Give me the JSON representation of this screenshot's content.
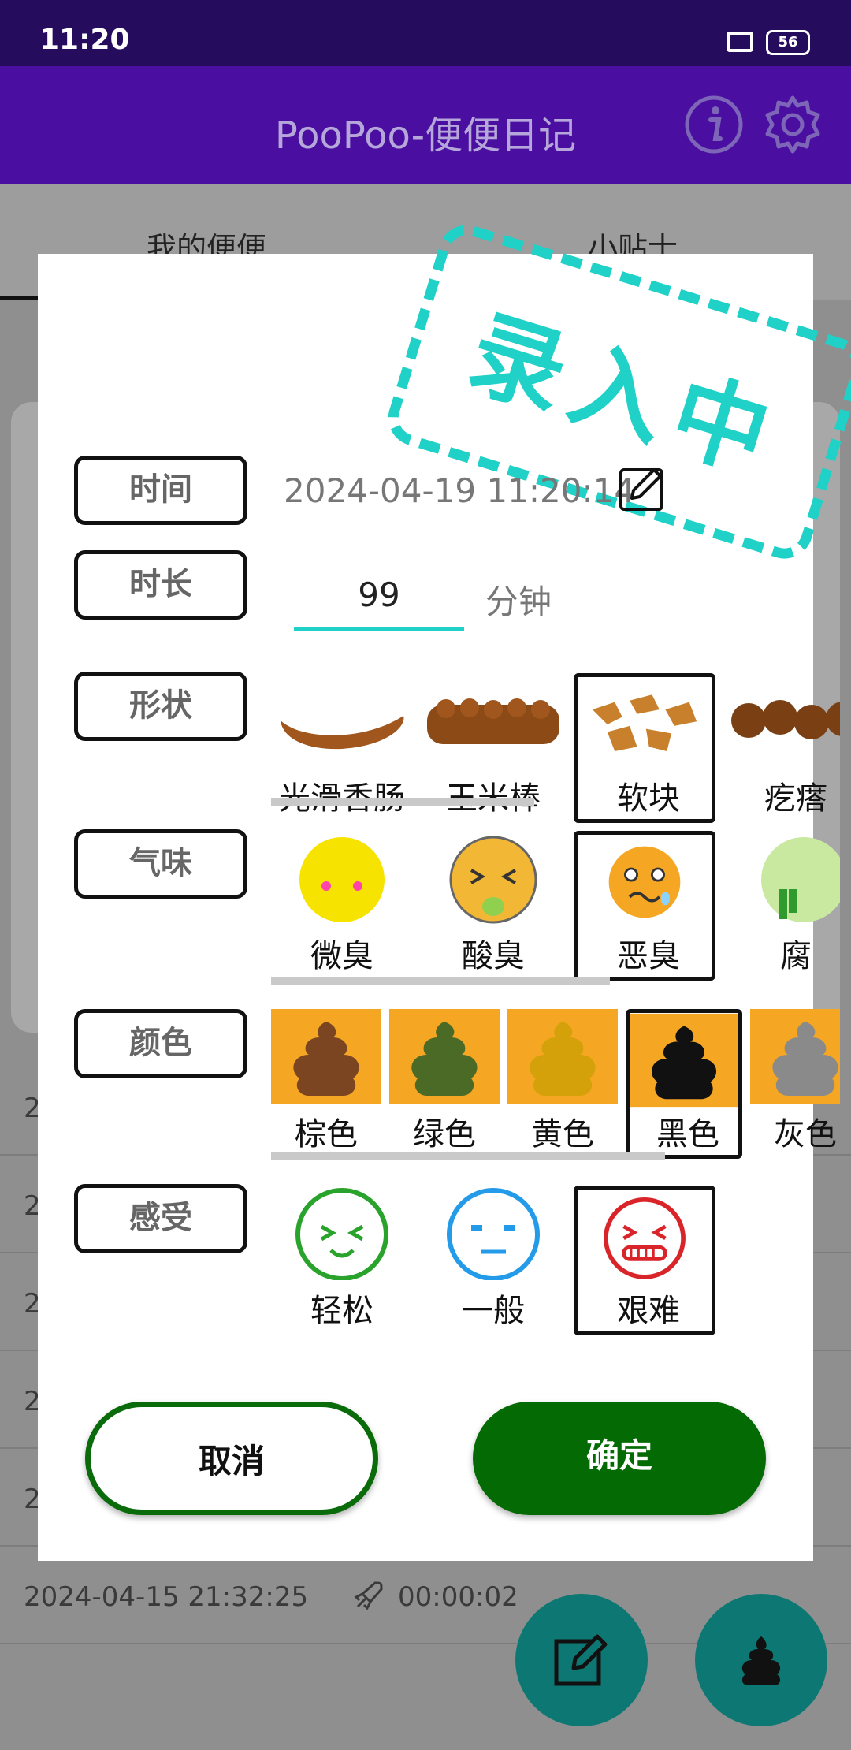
{
  "status": {
    "time": "11:20",
    "battery": "56"
  },
  "app": {
    "title": "PooPoo-便便日记"
  },
  "tabs": [
    "我的便便",
    "小贴士"
  ],
  "background_rows": [
    {
      "text": "2",
      "duration": ""
    },
    {
      "text": "2",
      "duration": ""
    },
    {
      "text": "2",
      "duration": ""
    },
    {
      "text": "2",
      "duration": ""
    },
    {
      "text": "2",
      "duration": ""
    },
    {
      "text": "2024-04-15 21:32:25",
      "duration": "00:00:02"
    }
  ],
  "dialog": {
    "stamp": "录入中",
    "labels": {
      "time": "时间",
      "duration": "时长",
      "shape": "形状",
      "smell": "气味",
      "color": "颜色",
      "feeling": "感受"
    },
    "datetime": "2024-04-19 11:20:14",
    "duration_value": "99",
    "duration_unit": "分钟",
    "shapes": [
      "光滑香肠",
      "玉米棒",
      "软块",
      "疙瘩"
    ],
    "shape_selected": 2,
    "smells": [
      "微臭",
      "酸臭",
      "恶臭",
      "腐"
    ],
    "smell_selected": 2,
    "colors": [
      "棕色",
      "绿色",
      "黄色",
      "黑色",
      "灰色"
    ],
    "color_selected": 3,
    "feelings": [
      "轻松",
      "一般",
      "艰难"
    ],
    "feeling_selected": 2,
    "cancel": "取消",
    "confirm": "确定"
  },
  "colors": {
    "status_bar": "#260c5c",
    "app_bar": "#4a0fa0",
    "accent": "#1fd1c6",
    "confirm": "#046b04",
    "fab": "#0d7873"
  }
}
